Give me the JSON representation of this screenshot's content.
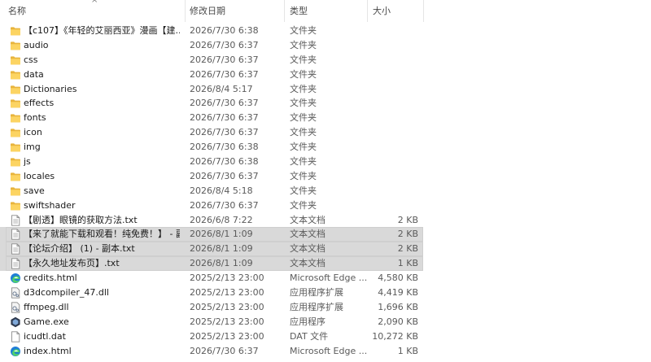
{
  "columns": {
    "name": "名称",
    "date": "修改日期",
    "type": "类型",
    "size": "大小"
  },
  "files": [
    {
      "name": "【c107】《年轻的艾丽西亚》漫画【建...",
      "date": "2026/7/30 6:38",
      "type": "文件夹",
      "size": "",
      "icon": "folder-icon",
      "selected": false
    },
    {
      "name": "audio",
      "date": "2026/7/30 6:37",
      "type": "文件夹",
      "size": "",
      "icon": "folder-icon",
      "selected": false
    },
    {
      "name": "css",
      "date": "2026/7/30 6:37",
      "type": "文件夹",
      "size": "",
      "icon": "folder-icon",
      "selected": false
    },
    {
      "name": "data",
      "date": "2026/7/30 6:37",
      "type": "文件夹",
      "size": "",
      "icon": "folder-icon",
      "selected": false
    },
    {
      "name": "Dictionaries",
      "date": "2026/8/4 5:17",
      "type": "文件夹",
      "size": "",
      "icon": "folder-icon",
      "selected": false
    },
    {
      "name": "effects",
      "date": "2026/7/30 6:37",
      "type": "文件夹",
      "size": "",
      "icon": "folder-icon",
      "selected": false
    },
    {
      "name": "fonts",
      "date": "2026/7/30 6:37",
      "type": "文件夹",
      "size": "",
      "icon": "folder-icon",
      "selected": false
    },
    {
      "name": "icon",
      "date": "2026/7/30 6:37",
      "type": "文件夹",
      "size": "",
      "icon": "folder-icon",
      "selected": false
    },
    {
      "name": "img",
      "date": "2026/7/30 6:38",
      "type": "文件夹",
      "size": "",
      "icon": "folder-icon",
      "selected": false
    },
    {
      "name": "js",
      "date": "2026/7/30 6:38",
      "type": "文件夹",
      "size": "",
      "icon": "folder-icon",
      "selected": false
    },
    {
      "name": "locales",
      "date": "2026/7/30 6:37",
      "type": "文件夹",
      "size": "",
      "icon": "folder-icon",
      "selected": false
    },
    {
      "name": "save",
      "date": "2026/8/4 5:18",
      "type": "文件夹",
      "size": "",
      "icon": "folder-icon",
      "selected": false
    },
    {
      "name": "swiftshader",
      "date": "2026/7/30 6:37",
      "type": "文件夹",
      "size": "",
      "icon": "folder-icon",
      "selected": false
    },
    {
      "name": "【剧透】眼镜的获取方法.txt",
      "date": "2026/6/8 7:22",
      "type": "文本文档",
      "size": "2 KB",
      "icon": "text-file-icon",
      "selected": false
    },
    {
      "name": "【来了就能下载和观看！纯免费！】 - 副...",
      "date": "2026/8/1 1:09",
      "type": "文本文档",
      "size": "2 KB",
      "icon": "text-file-icon",
      "selected": true
    },
    {
      "name": "【论坛介绍】 (1) - 副本.txt",
      "date": "2026/8/1 1:09",
      "type": "文本文档",
      "size": "2 KB",
      "icon": "text-file-icon",
      "selected": true
    },
    {
      "name": "【永久地址发布页】.txt",
      "date": "2026/8/1 1:09",
      "type": "文本文档",
      "size": "1 KB",
      "icon": "text-file-icon",
      "selected": true
    },
    {
      "name": "credits.html",
      "date": "2025/2/13 23:00",
      "type": "Microsoft Edge ...",
      "size": "4,580 KB",
      "icon": "edge-icon",
      "selected": false
    },
    {
      "name": "d3dcompiler_47.dll",
      "date": "2025/2/13 23:00",
      "type": "应用程序扩展",
      "size": "4,419 KB",
      "icon": "dll-file-icon",
      "selected": false
    },
    {
      "name": "ffmpeg.dll",
      "date": "2025/2/13 23:00",
      "type": "应用程序扩展",
      "size": "1,696 KB",
      "icon": "dll-file-icon",
      "selected": false
    },
    {
      "name": "Game.exe",
      "date": "2025/2/13 23:00",
      "type": "应用程序",
      "size": "2,090 KB",
      "icon": "game-exe-icon",
      "selected": false
    },
    {
      "name": "icudtl.dat",
      "date": "2025/2/13 23:00",
      "type": "DAT 文件",
      "size": "10,272 KB",
      "icon": "blank-file-icon",
      "selected": false
    },
    {
      "name": "index.html",
      "date": "2026/7/30 6:37",
      "type": "Microsoft Edge ...",
      "size": "1 KB",
      "icon": "edge-icon",
      "selected": false
    }
  ]
}
